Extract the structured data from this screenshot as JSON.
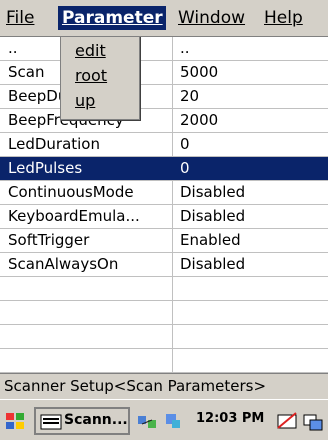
{
  "menubar": {
    "items": [
      {
        "label": "File"
      },
      {
        "label": "Parameter"
      },
      {
        "label": "Window"
      },
      {
        "label": "Help"
      }
    ]
  },
  "dropdown": {
    "items": [
      {
        "label": "edit"
      },
      {
        "label": "root"
      },
      {
        "label": "up"
      }
    ]
  },
  "grid": {
    "rows": [
      {
        "name": "..",
        "value": ".."
      },
      {
        "name": "Scan",
        "value": "5000"
      },
      {
        "name": "BeepDuration",
        "value": "20"
      },
      {
        "name": "BeepFrequency",
        "value": "2000"
      },
      {
        "name": "LedDuration",
        "value": "0"
      },
      {
        "name": "LedPulses",
        "value": "0",
        "selected": true
      },
      {
        "name": "ContinuousMode",
        "value": "Disabled"
      },
      {
        "name": "KeyboardEmula...",
        "value": "Disabled"
      },
      {
        "name": "SoftTrigger",
        "value": "Enabled"
      },
      {
        "name": "ScanAlwaysOn",
        "value": "Disabled"
      }
    ]
  },
  "status": {
    "text": "Scanner Setup<Scan Parameters>"
  },
  "taskbar": {
    "task_label": "Scann...",
    "clock": "12:03 PM"
  },
  "colors": {
    "selection": "#0a246a",
    "chrome": "#d4d0c8"
  }
}
